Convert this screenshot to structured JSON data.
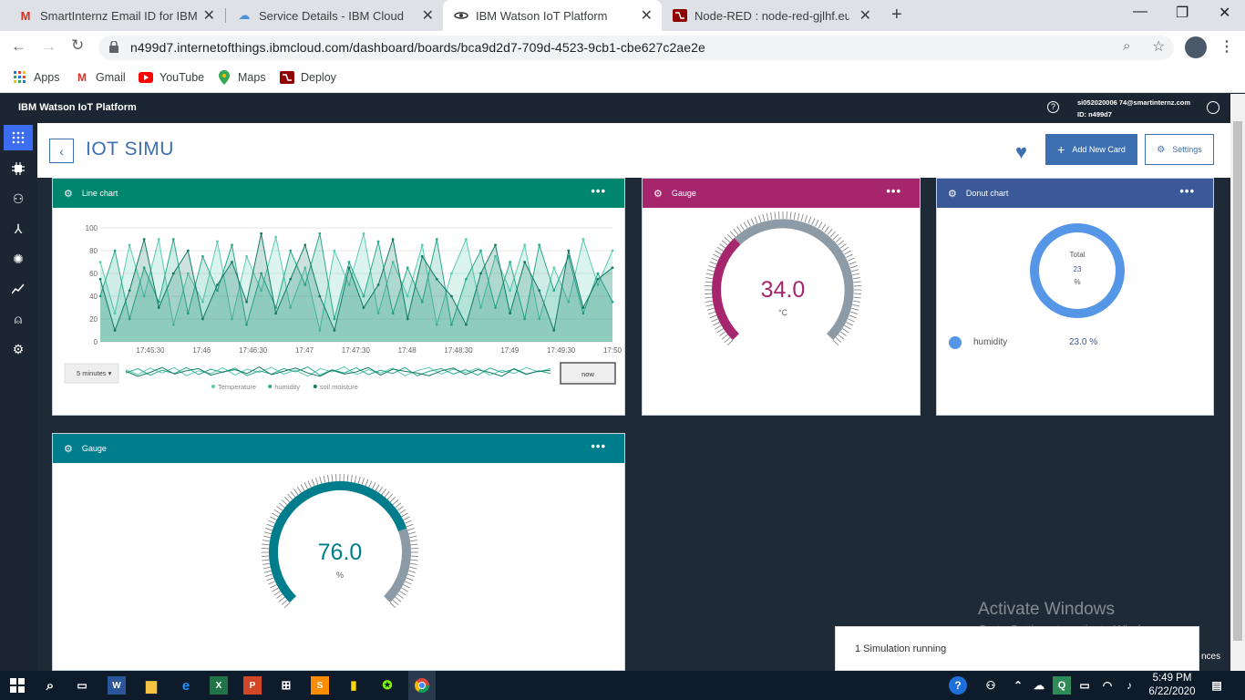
{
  "browser": {
    "tabs": [
      {
        "title": "SmartInternz Email ID for IBM Ac",
        "icon": "gmail-icon"
      },
      {
        "title": "Service Details - IBM Cloud",
        "icon": "cloud-icon"
      },
      {
        "title": "IBM Watson IoT Platform",
        "icon": "iot-icon"
      },
      {
        "title": "Node-RED : node-red-gjlhf.eu-gb",
        "icon": "node-red-icon"
      }
    ],
    "url": "n499d7.internetofthings.ibmcloud.com/dashboard/boards/bca9d2d7-709d-4523-9cb1-cbe627c2ae2e",
    "bookmarks": [
      {
        "label": "Apps",
        "icon": "apps-grid-icon"
      },
      {
        "label": "Gmail",
        "icon": "gmail-icon"
      },
      {
        "label": "YouTube",
        "icon": "youtube-icon"
      },
      {
        "label": "Maps",
        "icon": "maps-icon"
      },
      {
        "label": "Deploy",
        "icon": "deploy-icon"
      }
    ]
  },
  "header": {
    "brand": "IBM Watson IoT Platform",
    "user_email": "si052020006 74@smartinternz.com",
    "user_id": "ID: n499d7"
  },
  "board": {
    "title": "IOT SIMU",
    "add_card_label": "Add New Card",
    "settings_label": "Settings"
  },
  "cards": {
    "line": {
      "title": "Line chart",
      "range_label": "5 minutes",
      "now_label": "now",
      "color": "#00856f"
    },
    "gauge1": {
      "title": "Gauge",
      "value": "34.0",
      "unit": "°C",
      "color": "#a6266e"
    },
    "donut": {
      "title": "Donut chart",
      "total_label": "Total",
      "total_value": "23",
      "total_unit": "%",
      "legend_label": "humidity",
      "legend_value": "23.0 %",
      "color": "#3b5998"
    },
    "gauge2": {
      "title": "Gauge",
      "value": "76.0",
      "unit": "%",
      "color": "#007d8c"
    }
  },
  "chart_data": [
    {
      "type": "line",
      "title": "Line chart",
      "x": [
        "17:45:30",
        "17:46",
        "17:46:30",
        "17:47",
        "17:47:30",
        "17:48",
        "17:48:30",
        "17:49",
        "17:49:30",
        "17:50"
      ],
      "ylim": [
        0,
        100
      ],
      "yticks": [
        0,
        20,
        40,
        60,
        80,
        100
      ],
      "series": [
        {
          "name": "Temperature",
          "color": "#5ccbb3",
          "values": [
            70,
            25,
            85,
            40,
            90,
            15,
            60,
            35,
            88,
            20,
            75,
            45,
            92,
            30,
            65,
            10,
            80,
            50,
            95,
            25,
            70,
            40,
            85,
            15,
            60,
            90,
            30,
            75,
            45,
            85,
            20,
            65,
            35,
            90,
            50,
            80
          ]
        },
        {
          "name": "humidity",
          "color": "#2aa98c",
          "values": [
            40,
            80,
            20,
            65,
            35,
            90,
            25,
            75,
            45,
            85,
            15,
            60,
            30,
            80,
            50,
            95,
            20,
            70,
            40,
            88,
            25,
            65,
            35,
            90,
            15,
            55,
            80,
            30,
            70,
            20,
            85,
            45,
            75,
            25,
            60,
            35
          ]
        },
        {
          "name": "soil moisture",
          "color": "#137a66",
          "values": [
            55,
            10,
            45,
            90,
            30,
            60,
            80,
            20,
            50,
            70,
            35,
            95,
            25,
            55,
            85,
            40,
            10,
            65,
            30,
            50,
            90,
            20,
            75,
            55,
            40,
            15,
            60,
            85,
            25,
            70,
            45,
            10,
            80,
            30,
            55,
            65
          ]
        }
      ]
    },
    {
      "type": "gauge",
      "title": "Gauge",
      "value": 34.0,
      "unit": "°C"
    },
    {
      "type": "pie",
      "title": "Donut chart",
      "series": [
        {
          "name": "humidity",
          "values": [
            23.0
          ]
        }
      ]
    },
    {
      "type": "gauge",
      "title": "Gauge",
      "value": 76.0,
      "unit": "%"
    }
  ],
  "toast": {
    "text": "1 Simulation running",
    "trailing": "nces"
  },
  "watermark": {
    "line1": "Activate Windows",
    "line2": "Go to Settings to activate Windows."
  },
  "taskbar": {
    "time": "5:49 PM",
    "date": "6/22/2020"
  }
}
